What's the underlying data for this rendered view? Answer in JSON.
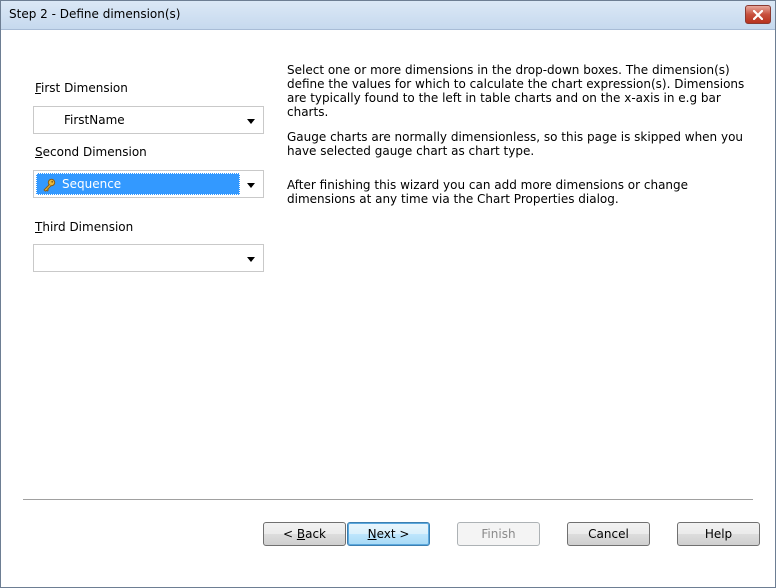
{
  "window": {
    "title": "Step 2 - Define dimension(s)"
  },
  "dimensions": {
    "first": {
      "label_acc": "F",
      "label_rest": "irst Dimension",
      "value": "FirstName"
    },
    "second": {
      "label_acc": "S",
      "label_rest": "econd Dimension",
      "value": "Sequence",
      "icon": "key-icon"
    },
    "third": {
      "label_acc": "T",
      "label_rest": "hird Dimension",
      "value": ""
    }
  },
  "help": {
    "para1": "Select one or more dimensions in the drop-down boxes. The dimension(s) define the values for which to calculate the chart expression(s). Dimensions are typically found to the left in table charts and on the x-axis in e.g bar charts.",
    "para2": "Gauge charts are normally dimensionless, so this page is skipped when you have selected gauge chart as chart type.",
    "para3": "After finishing this wizard you can add more dimensions or change dimensions at any time via the Chart Properties dialog."
  },
  "buttons": {
    "back_pre": "< ",
    "back_acc": "B",
    "back_rest": "ack",
    "next_acc": "N",
    "next_rest": "ext >",
    "finish": "Finish",
    "cancel": "Cancel",
    "help": "Help"
  },
  "colors": {
    "selection": "#3399ff",
    "close_button": "#c7503d"
  }
}
